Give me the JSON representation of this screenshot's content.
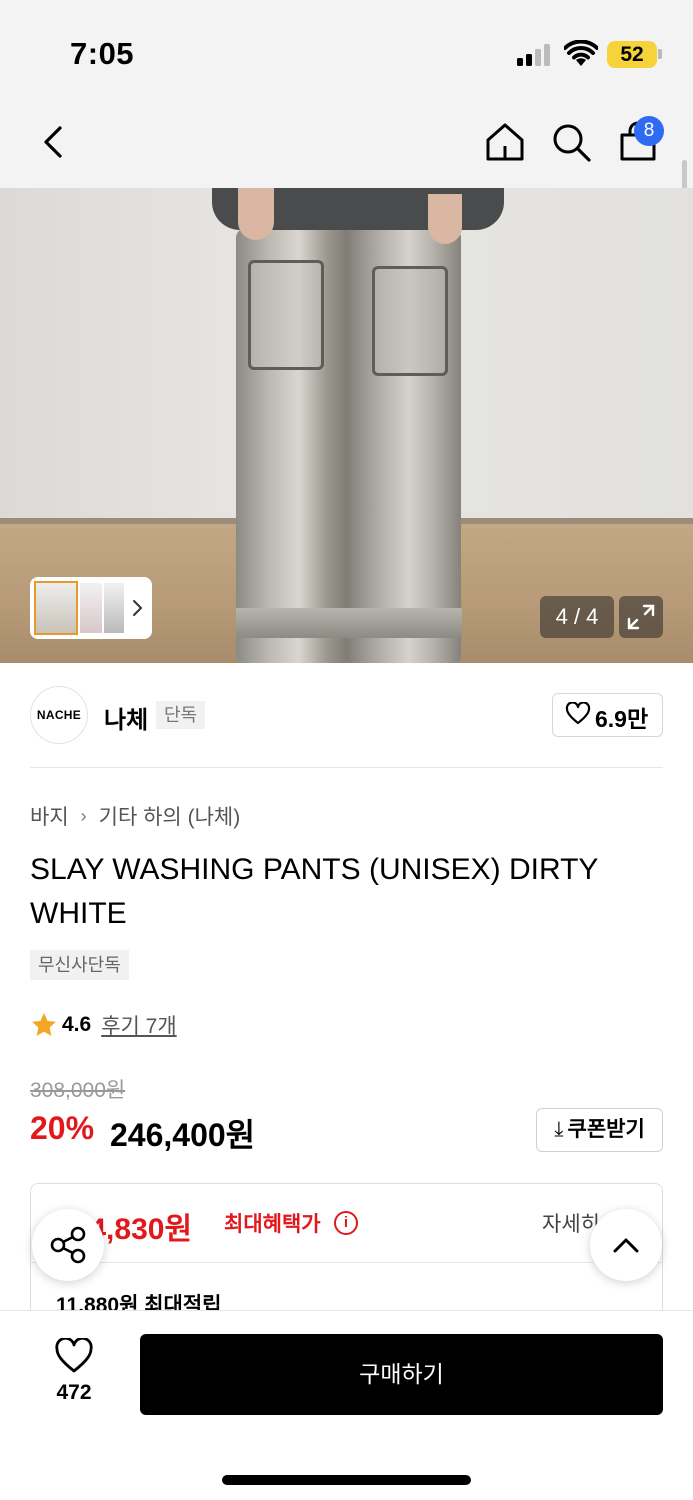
{
  "status_bar": {
    "time": "7:05",
    "battery": "52"
  },
  "header": {
    "cart_count": "8",
    "icons": [
      "back-arrow-icon",
      "home-icon",
      "search-icon",
      "shopping-bag-icon"
    ]
  },
  "gallery": {
    "counter": "4 / 4"
  },
  "brand": {
    "logo_text": "NACHE",
    "name": "나체",
    "tag": "단독",
    "likes": "6.9만"
  },
  "breadcrumb": {
    "level1": "바지",
    "level2": "기타 하의 (나체)"
  },
  "product": {
    "title": "SLAY WASHING PANTS (UNISEX) DIRTY WHITE",
    "exclusive_tag": "무신사단독",
    "rating": "4.6",
    "reviews": "후기 7개",
    "original_price": "308,000원",
    "discount": "20%",
    "price": "246,400원",
    "coupon_label": "쿠폰받기"
  },
  "benefits": {
    "max_price": "234,830원",
    "max_price_label": "최대혜택가",
    "detail_label": "자세히",
    "points": "11,880원 최대적립"
  },
  "bottom_bar": {
    "wish_count": "472",
    "buy_label": "구매하기"
  },
  "colors": {
    "accent_red": "#e1191d",
    "badge_blue": "#2f6bf2",
    "battery_yellow": "#f6d33a"
  }
}
